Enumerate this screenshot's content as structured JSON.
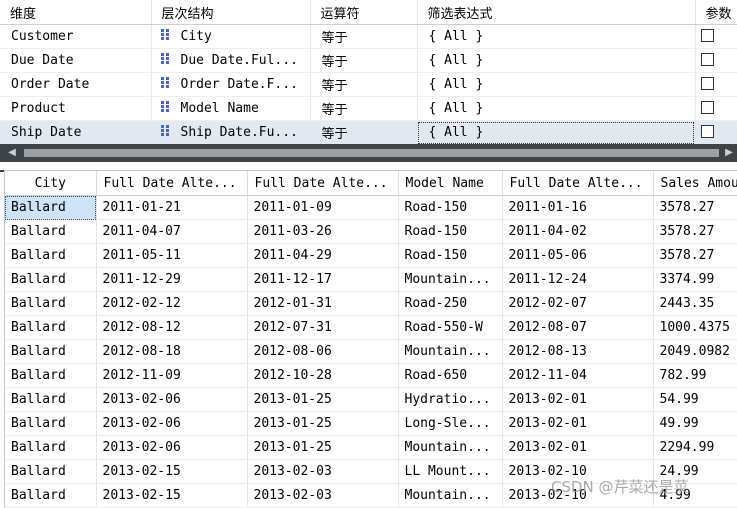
{
  "filter_grid": {
    "headers": [
      "维度",
      "层次结构",
      "运算符",
      "筛选表达式",
      "参数"
    ],
    "rows": [
      {
        "dimension": "Customer",
        "hierarchy": "City",
        "operator": "等于",
        "expression": "{ All }"
      },
      {
        "dimension": "Due Date",
        "hierarchy": "Due Date.Ful...",
        "operator": "等于",
        "expression": "{ All }"
      },
      {
        "dimension": "Order Date",
        "hierarchy": "Order Date.F...",
        "operator": "等于",
        "expression": "{ All }"
      },
      {
        "dimension": "Product",
        "hierarchy": "Model Name",
        "operator": "等于",
        "expression": "{ All }"
      },
      {
        "dimension": "Ship Date",
        "hierarchy": "Ship Date.Fu...",
        "operator": "等于",
        "expression": "{ All }"
      }
    ],
    "selected_row": 4
  },
  "result_grid": {
    "headers": [
      "City",
      "Full Date Alte...",
      "Full Date Alte...",
      "Model Name",
      "Full Date Alte...",
      "Sales Amount"
    ],
    "rows": [
      [
        "Ballard",
        "2011-01-21",
        "2011-01-09",
        "Road-150",
        "2011-01-16",
        "3578.27"
      ],
      [
        "Ballard",
        "2011-04-07",
        "2011-03-26",
        "Road-150",
        "2011-04-02",
        "3578.27"
      ],
      [
        "Ballard",
        "2011-05-11",
        "2011-04-29",
        "Road-150",
        "2011-05-06",
        "3578.27"
      ],
      [
        "Ballard",
        "2011-12-29",
        "2011-12-17",
        "Mountain...",
        "2011-12-24",
        "3374.99"
      ],
      [
        "Ballard",
        "2012-02-12",
        "2012-01-31",
        "Road-250",
        "2012-02-07",
        "2443.35"
      ],
      [
        "Ballard",
        "2012-08-12",
        "2012-07-31",
        "Road-550-W",
        "2012-08-07",
        "1000.4375"
      ],
      [
        "Ballard",
        "2012-08-18",
        "2012-08-06",
        "Mountain...",
        "2012-08-13",
        "2049.0982"
      ],
      [
        "Ballard",
        "2012-11-09",
        "2012-10-28",
        "Road-650",
        "2012-11-04",
        "782.99"
      ],
      [
        "Ballard",
        "2013-02-06",
        "2013-01-25",
        "Hydratio...",
        "2013-02-01",
        "54.99"
      ],
      [
        "Ballard",
        "2013-02-06",
        "2013-01-25",
        "Long-Sle...",
        "2013-02-01",
        "49.99"
      ],
      [
        "Ballard",
        "2013-02-06",
        "2013-01-25",
        "Mountain...",
        "2013-02-01",
        "2294.99"
      ],
      [
        "Ballard",
        "2013-02-15",
        "2013-02-03",
        "LL Mount...",
        "2013-02-10",
        "24.99"
      ],
      [
        "Ballard",
        "2013-02-15",
        "2013-02-03",
        "Mountain...",
        "2013-02-10",
        "4.99"
      ]
    ]
  },
  "scrollbar": {
    "left_arrow": "◀",
    "right_arrow": "▶"
  },
  "watermark": "CSDN @芹菜还是菜"
}
